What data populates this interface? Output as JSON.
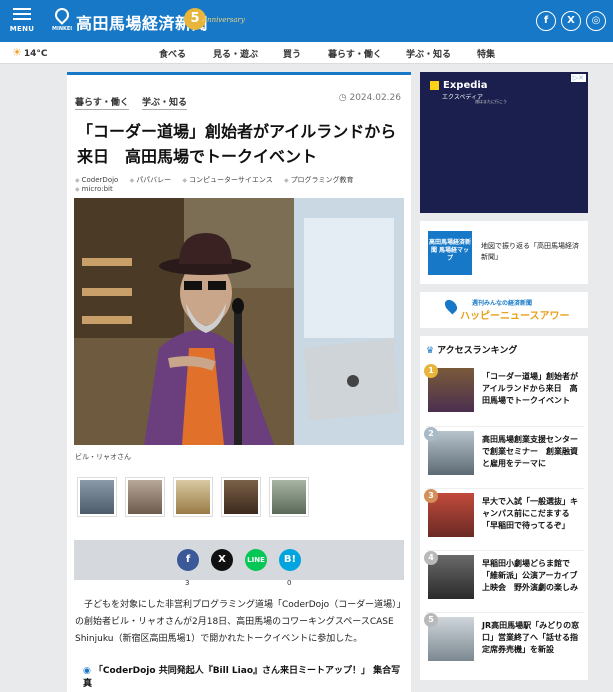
{
  "header": {
    "menu_label": "MENU",
    "logo_text": "MINKEI",
    "site_title": "高田馬場経済新聞",
    "anniversary_number": "5",
    "anniversary_word": "Anniversary",
    "social": [
      "f",
      "X",
      "◎"
    ]
  },
  "nav": {
    "weather": "14°C",
    "items": [
      "食べる",
      "見る・遊ぶ",
      "買う",
      "暮らす・働く",
      "学ぶ・知る",
      "特集"
    ]
  },
  "article": {
    "categories": [
      "暮らす・働く",
      "学ぶ・知る"
    ],
    "date": "2024.02.26",
    "title": "「コーダー道場」創始者がアイルランドから来日　高田馬場でトークイベント",
    "tags": [
      "CoderDojo",
      "パパバレー",
      "コンピューターサイエンス",
      "プログラミング教育",
      "micro:bit"
    ],
    "caption": "ビル・リャオさん",
    "share": {
      "facebook_count": "3",
      "hatena_count": "0",
      "line_label": "LINE",
      "hatena_label": "B!"
    },
    "body": "子どもを対象にした非営利プログラミング道場「CoderDojo（コーダー道場）」の創始者ビル・リャオさんが2月18日、高田馬場のコワーキングスペースCASE Shinjuku（新宿区高田馬場1）で開かれたトークイベントに参加した。",
    "subheading": "「CoderDojo 共同発起人『Bill Liao』さん来日ミートアップ！」 集合写真"
  },
  "sidebar": {
    "ad": {
      "brand": "Expedia",
      "brand_jp": "エクスペディア",
      "tagline": "旅はまたに行こう"
    },
    "map_card": {
      "image_text": "高田馬場経済新聞 馬場経マップ",
      "text": "地図で振り返る「高田馬場経済新聞」"
    },
    "happy": {
      "line1": "週刊みんなの経済新聞",
      "line2": "ハッピーニュースアワー"
    },
    "ranking": {
      "title": "アクセスランキング",
      "items": [
        {
          "rank": "1",
          "text": "「コーダー道場」創始者がアイルランドから来日　高田馬場でトークイベント"
        },
        {
          "rank": "2",
          "text": "高田馬場創業支援センターで創業セミナー　創業融資と雇用をテーマに"
        },
        {
          "rank": "3",
          "text": "早大で入試「一般選抜」キャンパス前にこだまする「早稲田で待ってるぞ」"
        },
        {
          "rank": "4",
          "text": "早稲田小劇場どらま館で「維新派」公演アーカイブ上映会　野外演劇の楽しみ"
        },
        {
          "rank": "5",
          "text": "JR高田馬場駅「みどりの窓口」営業終了へ「話せる指定席券売機」を新設"
        }
      ]
    }
  },
  "colors": {
    "brand_blue": "#1678c7",
    "facebook": "#3b5998",
    "x": "#111111",
    "line": "#06c755",
    "hatena": "#00a4de",
    "rank_gold": "#e7b53b",
    "rank_silver": "#a8b9c8",
    "rank_bronze": "#d4905a",
    "rank_other": "#b9b9b9"
  }
}
